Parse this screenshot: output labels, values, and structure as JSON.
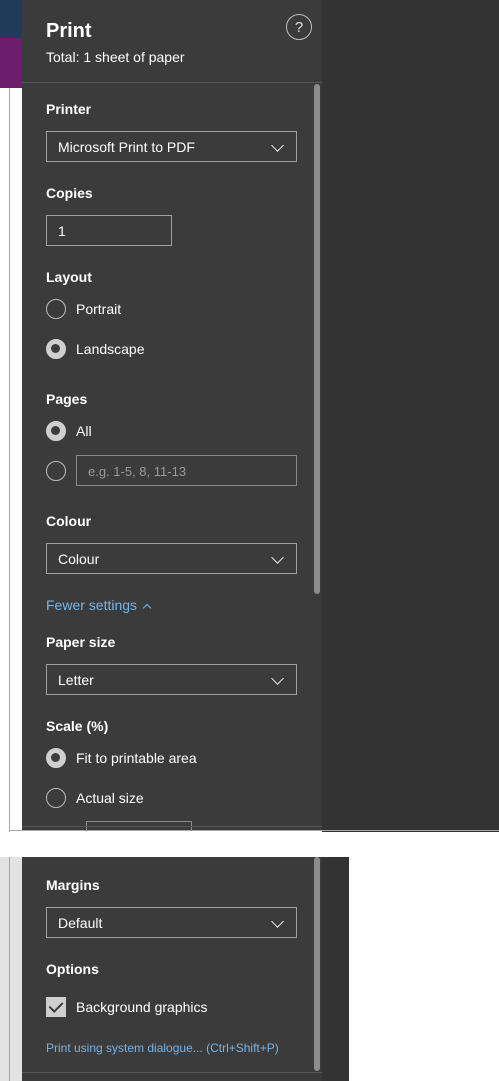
{
  "header": {
    "title": "Print",
    "subtitle": "Total: 1 sheet of paper",
    "help_label": "?"
  },
  "printer": {
    "label": "Printer",
    "value": "Microsoft Print to PDF"
  },
  "copies": {
    "label": "Copies",
    "value": "1"
  },
  "layout": {
    "label": "Layout",
    "options": [
      "Portrait",
      "Landscape"
    ],
    "selected": "Landscape"
  },
  "pages": {
    "label": "Pages",
    "all_label": "All",
    "custom_placeholder": "e.g. 1-5, 8, 11-13",
    "selected": "All"
  },
  "colour": {
    "label": "Colour",
    "value": "Colour"
  },
  "fewer_settings": "Fewer settings",
  "paper_size": {
    "label": "Paper size",
    "value": "Letter"
  },
  "scale": {
    "label": "Scale (%)",
    "options": [
      "Fit to printable area",
      "Actual size"
    ],
    "selected": "Fit to printable area"
  },
  "margins": {
    "label": "Margins",
    "value": "Default"
  },
  "options": {
    "label": "Options",
    "background_graphics": "Background graphics",
    "background_graphics_checked": true
  },
  "system_dialog_link": "Print using system dialogue... (Ctrl+Shift+P)",
  "colors": {
    "panel_bg": "#3b3b3b",
    "preview_bg": "#333333",
    "link": "#78b3e6",
    "accent_purple": "#6d1d6e"
  }
}
